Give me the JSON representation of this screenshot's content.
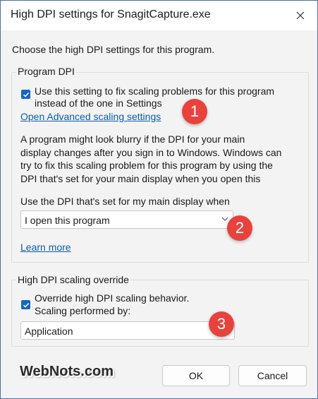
{
  "window": {
    "title": "High DPI settings for SnagitCapture.exe"
  },
  "intro": "Choose the high DPI settings for this program.",
  "program_dpi": {
    "label": "Program DPI",
    "checkbox_line1": "Use this setting to fix scaling problems for this program",
    "checkbox_line2": "instead of the one in Settings",
    "checked": true,
    "link": "Open Advanced scaling settings",
    "paragraph_lines": [
      "A program might look blurry if the DPI for your main",
      "display changes after you sign in to Windows. Windows can",
      "try to fix this scaling problem for this program by using the",
      "DPI that's set for your main display when you open this"
    ],
    "dropdown_label": "Use the DPI that's set for my main display when",
    "dropdown_value": "I open this program",
    "learn_more": "Learn more"
  },
  "override": {
    "label": "High DPI scaling override",
    "checkbox_line1": "Override high DPI scaling behavior.",
    "checkbox_line2": "Scaling performed by:",
    "checked": true,
    "dropdown_value": "Application"
  },
  "badges": [
    "1",
    "2",
    "3"
  ],
  "buttons": {
    "ok": "OK",
    "cancel": "Cancel"
  },
  "watermark": "WebNots.com",
  "colors": {
    "accent": "#1765c0",
    "link": "#0b5cad",
    "badge": "#e8423d"
  }
}
